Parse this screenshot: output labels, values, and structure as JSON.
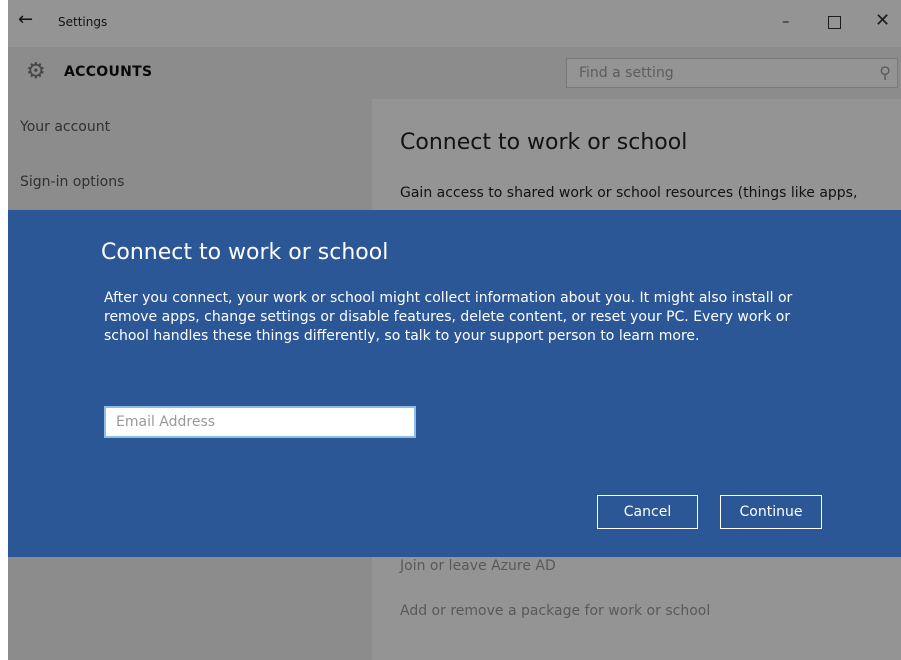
{
  "window": {
    "title": "Settings",
    "back_glyph": "←",
    "minimize_glyph": "–",
    "close_glyph": "✕"
  },
  "header": {
    "title": "ACCOUNTS",
    "icon": "gear-icon",
    "search_placeholder": "Find a setting"
  },
  "nav": {
    "items": [
      {
        "label": "Your account"
      },
      {
        "label": "Sign-in options"
      }
    ]
  },
  "main": {
    "title": "Connect to work or school",
    "description": "Gain access to shared work or school resources (things like apps,",
    "links": [
      {
        "label": "Join or leave Azure AD"
      },
      {
        "label": "Add or remove a package for work or school"
      }
    ]
  },
  "dialog": {
    "title": "Connect to work or school",
    "body": "After you connect, your work or school might collect information about you. It might also install or remove apps, change settings or disable features, delete content, or reset your PC. Every work or school handles these things differently, so talk to your support person to learn more.",
    "email_placeholder": "Email Address",
    "email_value": "",
    "cancel_label": "Cancel",
    "continue_label": "Continue"
  },
  "colors": {
    "dialog_bg": "#2b5797",
    "email_border": "#8bbfe8",
    "nav_bg": "#f2f2f2"
  }
}
